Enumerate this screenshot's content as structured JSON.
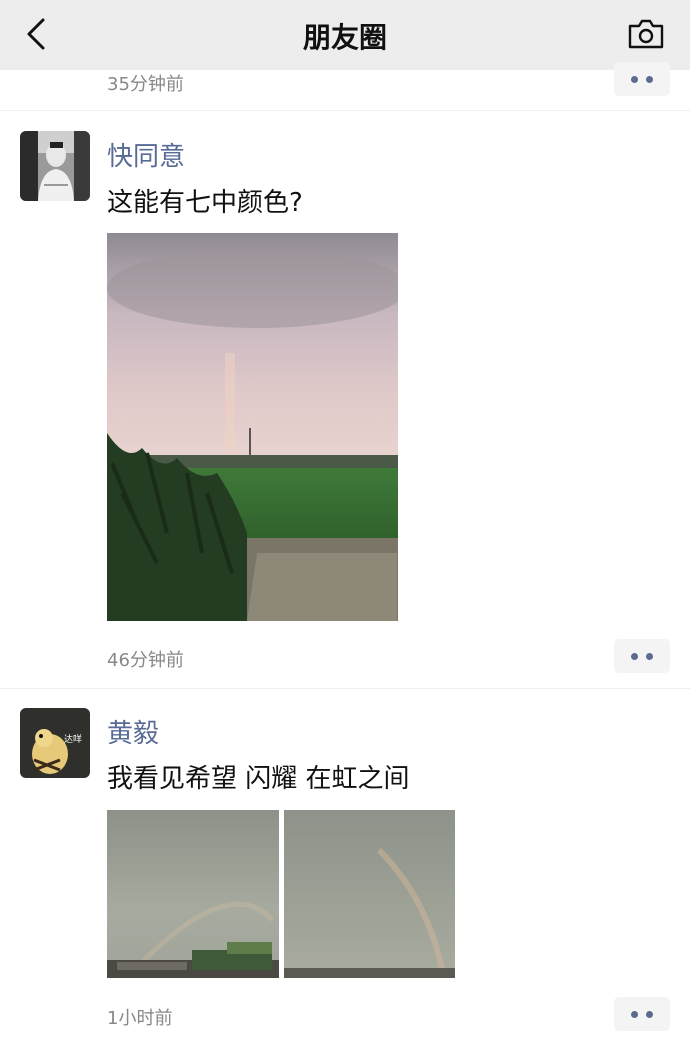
{
  "nav": {
    "title": "朋友圈",
    "back_icon": "chevron-left-icon",
    "camera_icon": "camera-icon"
  },
  "prev_post": {
    "time": "35分钟前"
  },
  "posts": [
    {
      "author": "快同意",
      "text": "这能有七中颜色?",
      "time": "46分钟前",
      "image_count": 1
    },
    {
      "author": "黄毅",
      "text": "我看见希望 闪耀 在虹之间",
      "avatar_tag": "达咩",
      "time": "1小时前",
      "image_count": 2
    }
  ],
  "colors": {
    "nav_bg": "#ededed",
    "author_name": "#576b95",
    "time_text": "#888888",
    "more_dots": "#5b6b8f"
  }
}
